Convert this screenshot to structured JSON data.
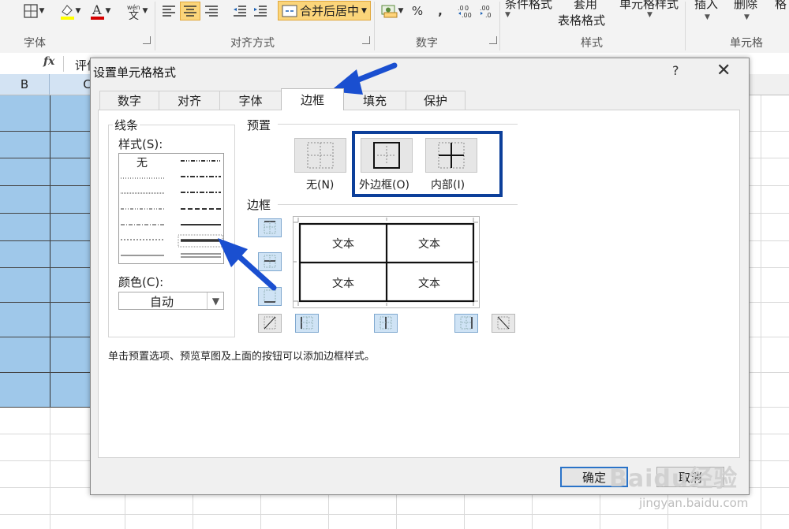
{
  "ribbon": {
    "groups": {
      "font": "字体",
      "alignment": "对齐方式",
      "number": "数字",
      "styles": "样式",
      "cells": "单元格"
    },
    "merge_center": "合并后居中",
    "percent": "%",
    "comma": ",",
    "conditional_format": "条件格式",
    "apply_line1": "套用",
    "apply_line2": "表格格式",
    "cell_style": "单元格样式",
    "insert": "插入",
    "delete": "删除",
    "format": "格"
  },
  "formula_bar": {
    "fx": "fx",
    "text": "评估表"
  },
  "columns": [
    "B",
    "C"
  ],
  "dialog": {
    "title": "设置单元格格式",
    "help": "?",
    "close": "✕",
    "tabs": [
      {
        "label": "数字"
      },
      {
        "label": "对齐"
      },
      {
        "label": "字体"
      },
      {
        "label": "边框"
      },
      {
        "label": "填充"
      },
      {
        "label": "保护"
      }
    ],
    "active_tab": "边框",
    "line": {
      "group_label": "线条",
      "style_label": "样式(S):",
      "none_label": "无",
      "color_label": "颜色(C):",
      "color_value": "自动"
    },
    "presets": {
      "group_label": "预置",
      "none": "无(N)",
      "outline": "外边框(O)",
      "inside": "内部(I)"
    },
    "border": {
      "group_label": "边框",
      "cell_text": [
        "文本",
        "文本",
        "文本",
        "文本"
      ]
    },
    "hint": "单击预置选项、预览草图及上面的按钮可以添加边框样式。",
    "ok": "确定",
    "cancel": "取消"
  },
  "colors": {
    "highlight": "#0c3f9a",
    "arrow": "#1a4fd0",
    "selected_cells": "#9fc8ea",
    "merge_button": "#fbd57a"
  },
  "watermark": {
    "brand": "Baidu经验",
    "url": "jingyan.baidu.com"
  }
}
